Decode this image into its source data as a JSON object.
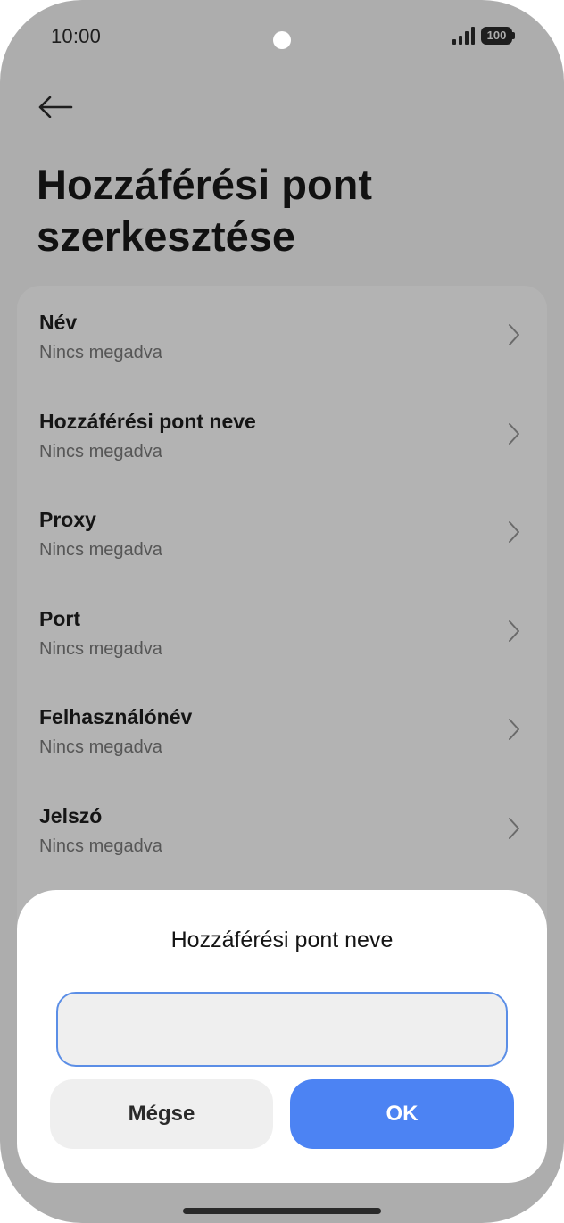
{
  "status_bar": {
    "time": "10:00",
    "battery": "100",
    "signal_icon": "signal-bars-icon",
    "battery_icon": "battery-icon"
  },
  "header": {
    "back_icon": "arrow-left-icon",
    "title": "Hozzáférési pont\nszerkesztése"
  },
  "settings": {
    "items": [
      {
        "title": "Név",
        "value": "Nincs megadva"
      },
      {
        "title": "Hozzáférési pont neve",
        "value": "Nincs megadva"
      },
      {
        "title": "Proxy",
        "value": "Nincs megadva"
      },
      {
        "title": "Port",
        "value": "Nincs megadva"
      },
      {
        "title": "Felhasználónév",
        "value": "Nincs megadva"
      },
      {
        "title": "Jelszó",
        "value": "Nincs megadva"
      }
    ],
    "chevron_icon": "chevron-right-icon"
  },
  "dialog": {
    "title": "Hozzáférési pont neve",
    "input_value": "",
    "cancel_label": "Mégse",
    "ok_label": "OK"
  },
  "colors": {
    "accent": "#4c83f3",
    "input_border": "#5b8ee6",
    "overlay": "#adadad"
  }
}
